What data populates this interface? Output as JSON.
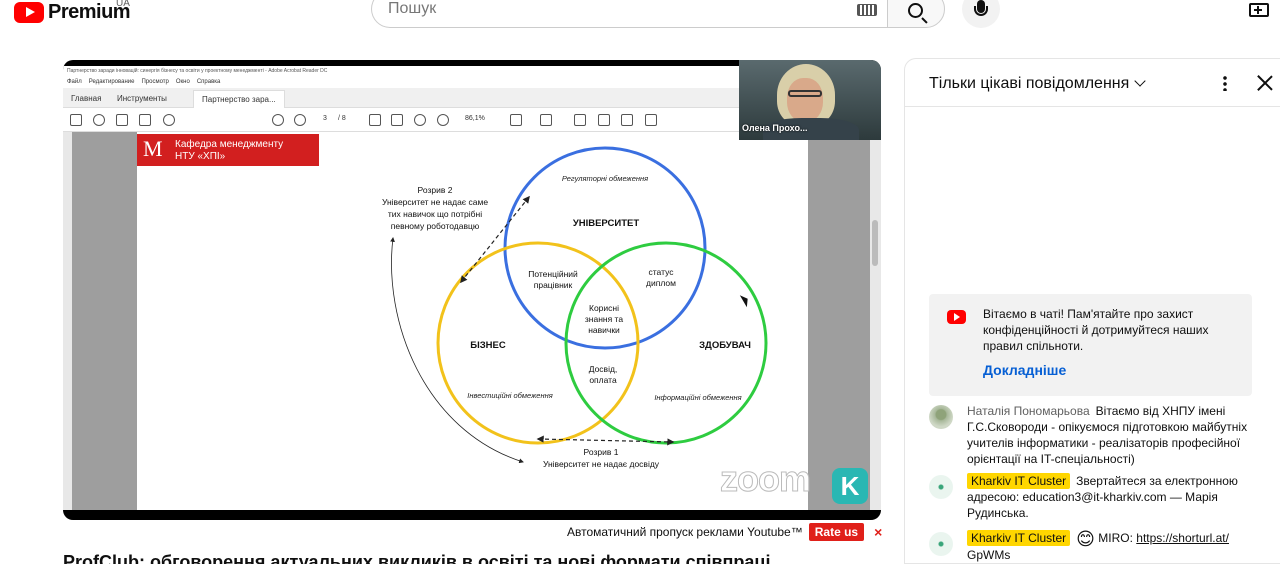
{
  "masthead": {
    "brand": "Premium",
    "country": "UA",
    "search_placeholder": "Пошук"
  },
  "player": {
    "pdf_window_title": "Партнерство заради інновацій: синергія бізнесу та освіти у проектному менеджменті - Adobe Acrobat Reader DC",
    "pdf_menu": [
      "Файл",
      "Редактирование",
      "Просмотр",
      "Окно",
      "Справка"
    ],
    "pdf_tabs": [
      "Главная",
      "Инструменты",
      "Партнерство зара..."
    ],
    "page_current": "3",
    "page_total": "/ 8",
    "zoom": "86,1%",
    "banner_logo": "M",
    "banner_line1": "Кафедра менеджменту",
    "banner_line2": "НТУ «ХПІ»",
    "diagram": {
      "university": "УНІВЕРСИТЕТ",
      "university_note": "Регуляторні обмеження",
      "business": "БІЗНЕС",
      "business_note": "Інвестиційні обмеження",
      "student": "ЗДОБУВАЧ",
      "student_note": "Інформаційні обмеження",
      "overlap_ub_1": "Потенційний",
      "overlap_ub_2": "працівник",
      "overlap_us_1": "статус",
      "overlap_us_2": "диплом",
      "center_1": "Корисні",
      "center_2": "знання та",
      "center_3": "навички",
      "overlap_bs_1": "Досвід,",
      "overlap_bs_2": "оплата",
      "gap2_1": "Розрив 2",
      "gap2_2": "Університет не надає саме",
      "gap2_3": "тих навичок що потрібні",
      "gap2_4": "певному роботодавцю",
      "gap1_1": "Розрив 1",
      "gap1_2": "Університет не надає досвіду"
    },
    "camera_name": "Олена Прохо...",
    "zoom_watermark": "zoom",
    "k_badge": "K"
  },
  "ad": {
    "text": "Автоматичний пропуск реклами Youtube™",
    "rate_label": "Rate us",
    "close": "×"
  },
  "video_title": "ProfClub: обговорення актуальних викликів в освіті та нові формати співпраці",
  "chat": {
    "mode_label": "Тільки цікаві повідомлення",
    "welcome_text": "Вітаємо в чаті! Пам'ятайте про захист конфіденційності й дотримуйтеся наших правил спільноти.",
    "welcome_link": "Докладніше",
    "messages": [
      {
        "author": "Наталія Пономарьова",
        "text": "Вітаємо від ХНПУ імені Г.С.Сковороди - опікуємося підготовкою майбутніх учителів інформатики - реалізаторів професійної орієнтації на IT-спеціальності)"
      },
      {
        "author": "Kharkiv IT Cluster",
        "text": "Звертайтеся за електронною адресою: education3@it-kharkiv.com — Марія Рудинська."
      },
      {
        "author": "Kharkiv IT Cluster",
        "emoji": "😊",
        "text": "MIRO:",
        "link": "https://shorturl.at/",
        "tail": "GpWMs"
      }
    ]
  },
  "colors": {
    "youtube_red": "#ff0000",
    "circle_university": "#3a6fe0",
    "circle_business": "#f2c21b",
    "circle_student": "#2ecc40",
    "chip_yellow": "#ffd600",
    "link_blue": "#065fd4"
  }
}
